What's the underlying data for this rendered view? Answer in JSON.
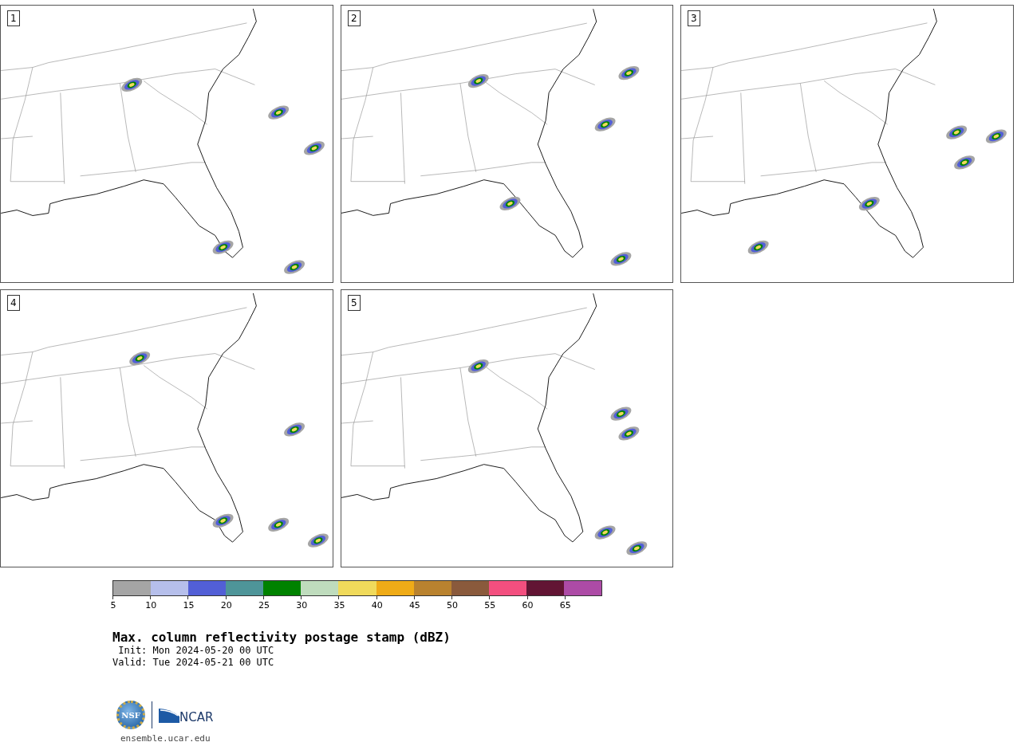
{
  "panels": [
    {
      "label": "1"
    },
    {
      "label": "2"
    },
    {
      "label": "3"
    },
    {
      "label": "4"
    },
    {
      "label": "5"
    }
  ],
  "colorbar": {
    "segments": [
      {
        "color": "#a5a5a5",
        "tick": "5"
      },
      {
        "color": "#b6bfeb",
        "tick": "10"
      },
      {
        "color": "#525fd6",
        "tick": "15"
      },
      {
        "color": "#4e9599",
        "tick": "20"
      },
      {
        "color": "#008200",
        "tick": "25"
      },
      {
        "color": "#bfdcbd",
        "tick": "30"
      },
      {
        "color": "#f0da5b",
        "tick": "35"
      },
      {
        "color": "#efab17",
        "tick": "40"
      },
      {
        "color": "#b9822f",
        "tick": "45"
      },
      {
        "color": "#8a5a3c",
        "tick": "50"
      },
      {
        "color": "#f34f7f",
        "tick": "55"
      },
      {
        "color": "#621534",
        "tick": "60"
      },
      {
        "color": "#ad4ba6",
        "tick": "65"
      }
    ]
  },
  "title": "Max. column reflectivity postage stamp (dBZ)",
  "init": " Init: Mon 2024-05-20 00 UTC",
  "valid": "Valid: Tue 2024-05-21 00 UTC",
  "logos": {
    "nsf": "NSF",
    "ncar": "NCAR"
  },
  "link": "ensemble.ucar.edu"
}
